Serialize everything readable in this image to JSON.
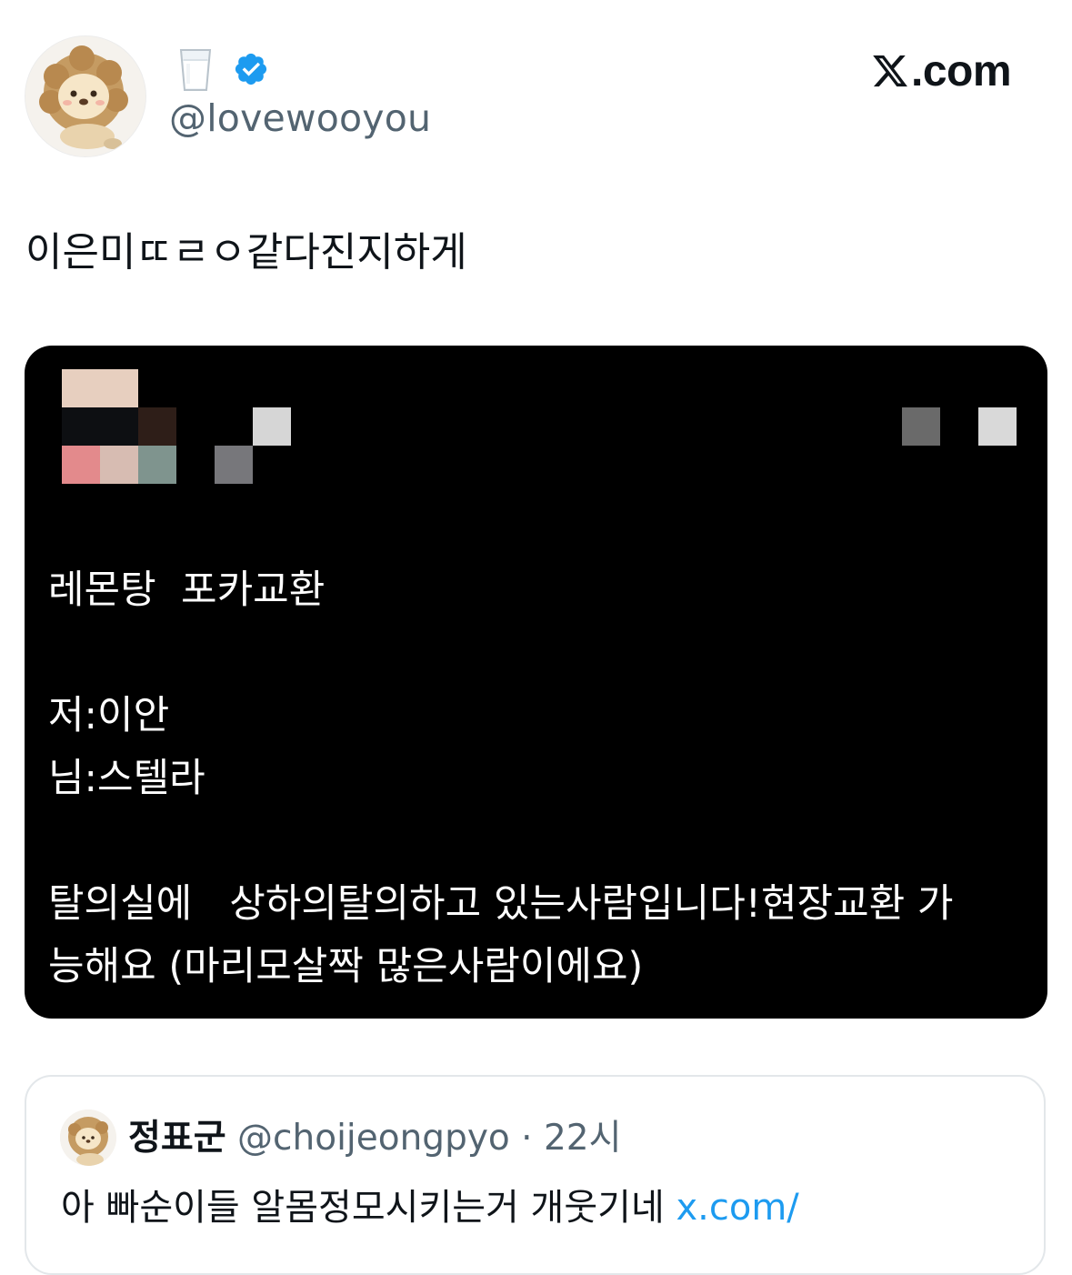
{
  "header": {
    "avatar_icon": "lion-avatar-icon",
    "name_emoji": "🥛",
    "verified_icon": "verified-badge-icon",
    "handle": "@lovewooyou",
    "site_label": ".com",
    "site_logo_icon": "x-logo-icon"
  },
  "tweet": {
    "text": "이은미ㄸㄹㅇ같다진지하게"
  },
  "media": {
    "lines": [
      "레몬탕  포카교환",
      "저:이안",
      "님:스텔라",
      "탈의실에   상하의탈의하고 있는사람입니다!현장교환 가",
      "능해요 (마리모살짝 많은사람이에요)"
    ]
  },
  "quote": {
    "avatar_icon": "lion-avatar-icon",
    "name": "정표군",
    "handle": "@choijeongpyo",
    "separator": " · ",
    "time": "22시",
    "text": "아 빠순이들 알몸정모시키는거 개웃기네 ",
    "link": "x.com/"
  },
  "colors": {
    "text": "#0f1419",
    "secondary": "#536471",
    "verified": "#1d9bf0",
    "link": "#1d9bf0",
    "media_bg": "#000000",
    "border": "#e3e7ea"
  }
}
